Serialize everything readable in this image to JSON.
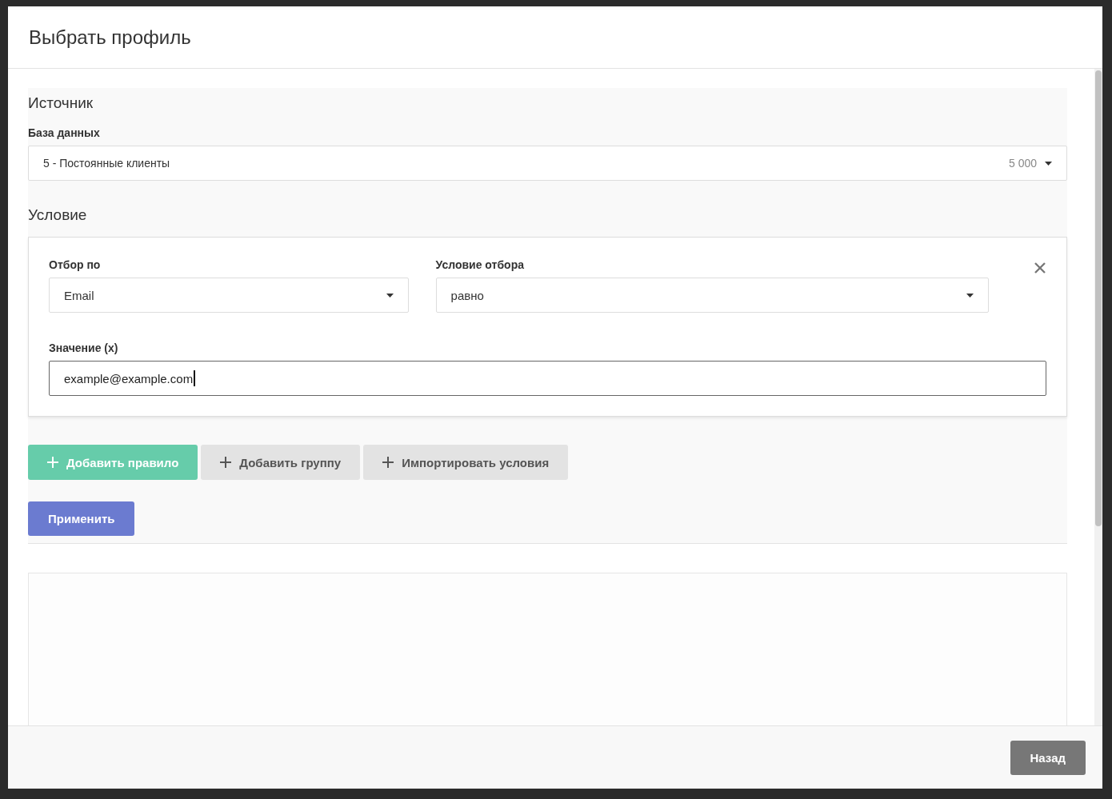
{
  "dialog": {
    "title": "Выбрать профиль"
  },
  "source": {
    "heading": "Источник",
    "database": {
      "label": "База данных",
      "value": "5 - Постоянные клиенты",
      "count": "5 000"
    }
  },
  "condition": {
    "heading": "Условие",
    "rules": [
      {
        "field": {
          "label": "Отбор по",
          "value": "Email"
        },
        "operator": {
          "label": "Условие отбора",
          "value": "равно"
        },
        "value": {
          "label": "Значение (x)",
          "value": "example@example.com",
          "focused": true
        }
      }
    ]
  },
  "actions": [
    {
      "label": "Добавить правило",
      "kind": "primary"
    },
    {
      "label": "Добавить группу",
      "kind": "secondary"
    },
    {
      "label": "Импортировать условия",
      "kind": "secondary"
    }
  ],
  "apply_button": "Применить",
  "back_button": "Назад"
}
